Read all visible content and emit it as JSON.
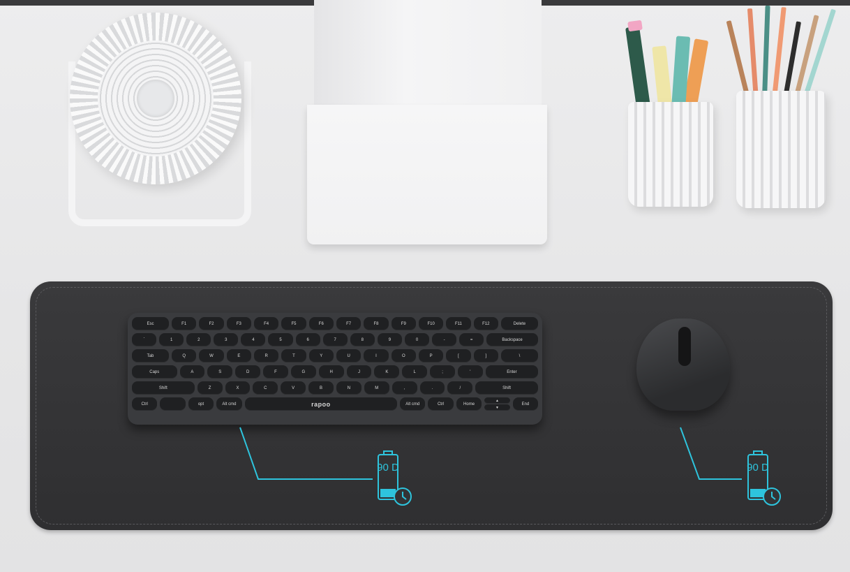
{
  "keyboard": {
    "brand": "rapoo",
    "rows": [
      [
        "Esc",
        "F1",
        "F2",
        "F3",
        "F4",
        "F5",
        "F6",
        "F7",
        "F8",
        "F9",
        "F10",
        "F11",
        "F12",
        "Delete"
      ],
      [
        "`",
        "1",
        "2",
        "3",
        "4",
        "5",
        "6",
        "7",
        "8",
        "9",
        "0",
        "-",
        "=",
        "Backspace"
      ],
      [
        "Tab",
        "Q",
        "W",
        "E",
        "R",
        "T",
        "Y",
        "U",
        "I",
        "O",
        "P",
        "[",
        "]",
        "\\"
      ],
      [
        "Caps",
        "A",
        "S",
        "D",
        "F",
        "G",
        "H",
        "J",
        "K",
        "L",
        ";",
        "'",
        "Enter"
      ],
      [
        "Shift",
        "Z",
        "X",
        "C",
        "V",
        "B",
        "N",
        "M",
        ",",
        ".",
        "/",
        "Shift"
      ],
      [
        "Ctrl",
        "",
        "opt",
        "Alt cmd",
        "",
        "Alt cmd",
        "Ctrl",
        "Home",
        "",
        "End"
      ]
    ]
  },
  "battery_badges": {
    "keyboard": "90 D",
    "mouse": "90 D"
  },
  "colors": {
    "accent": "#2ec4dd",
    "mat": "#333335",
    "background": "#e9e9ea"
  }
}
